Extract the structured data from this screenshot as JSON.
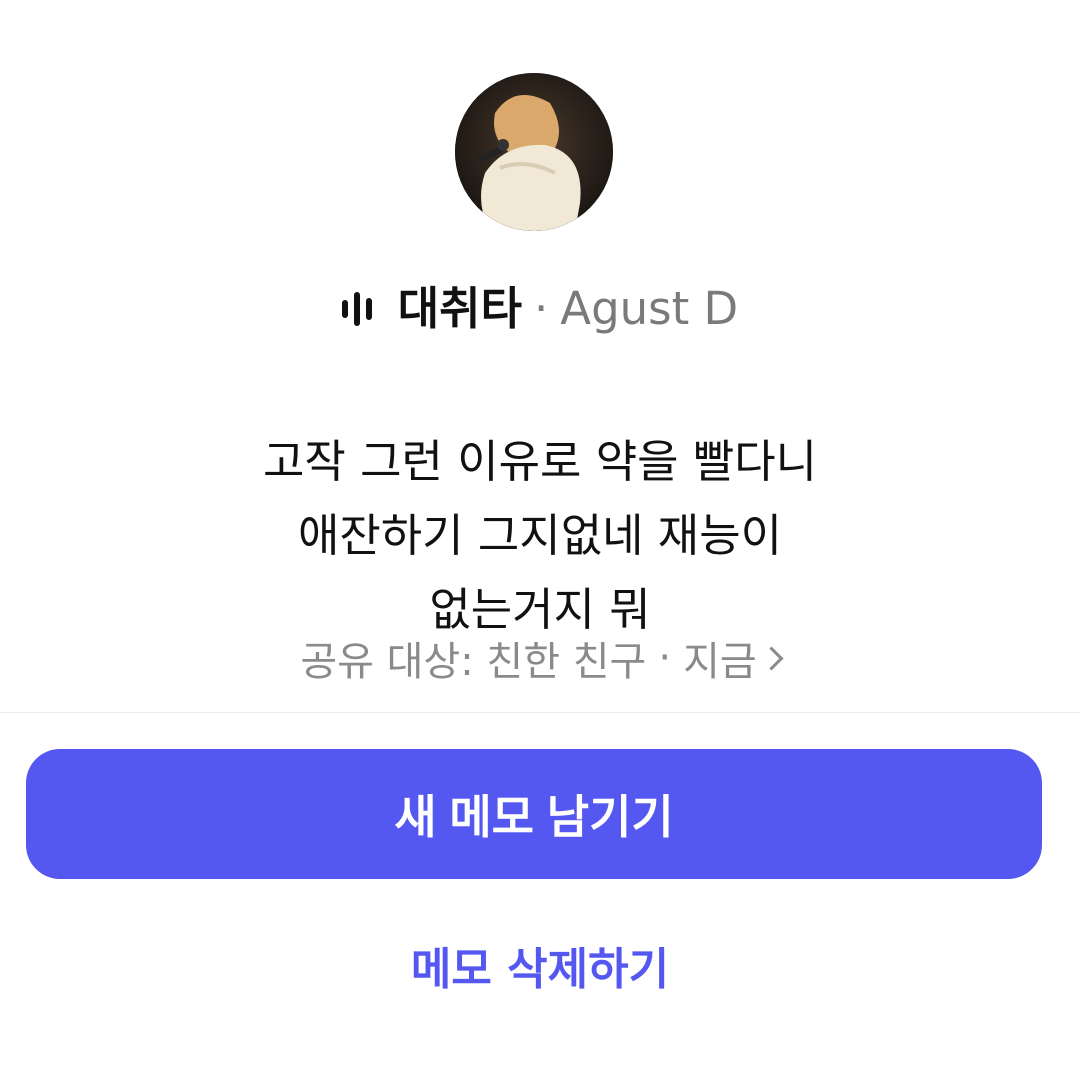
{
  "song": {
    "title": "대취타",
    "separator": "·",
    "artist": "Agust D",
    "icon": "audio-wave-icon"
  },
  "avatar": {
    "icon": "profile-avatar-photo"
  },
  "memo": {
    "lines": [
      "고작 그런 이유로 약을 빨다니",
      "애잔하기 그지없네 재능이",
      "없는거지 뭐"
    ]
  },
  "share": {
    "text": "공유 대상: 친한 친구",
    "separator": "·",
    "time": "지금",
    "icon": "chevron-right-icon"
  },
  "actions": {
    "primary_label": "새 메모 남기기",
    "secondary_label": "메모 삭제하기"
  },
  "colors": {
    "accent": "#5458f1",
    "muted_text": "#8a8a8a",
    "text": "#111111"
  }
}
